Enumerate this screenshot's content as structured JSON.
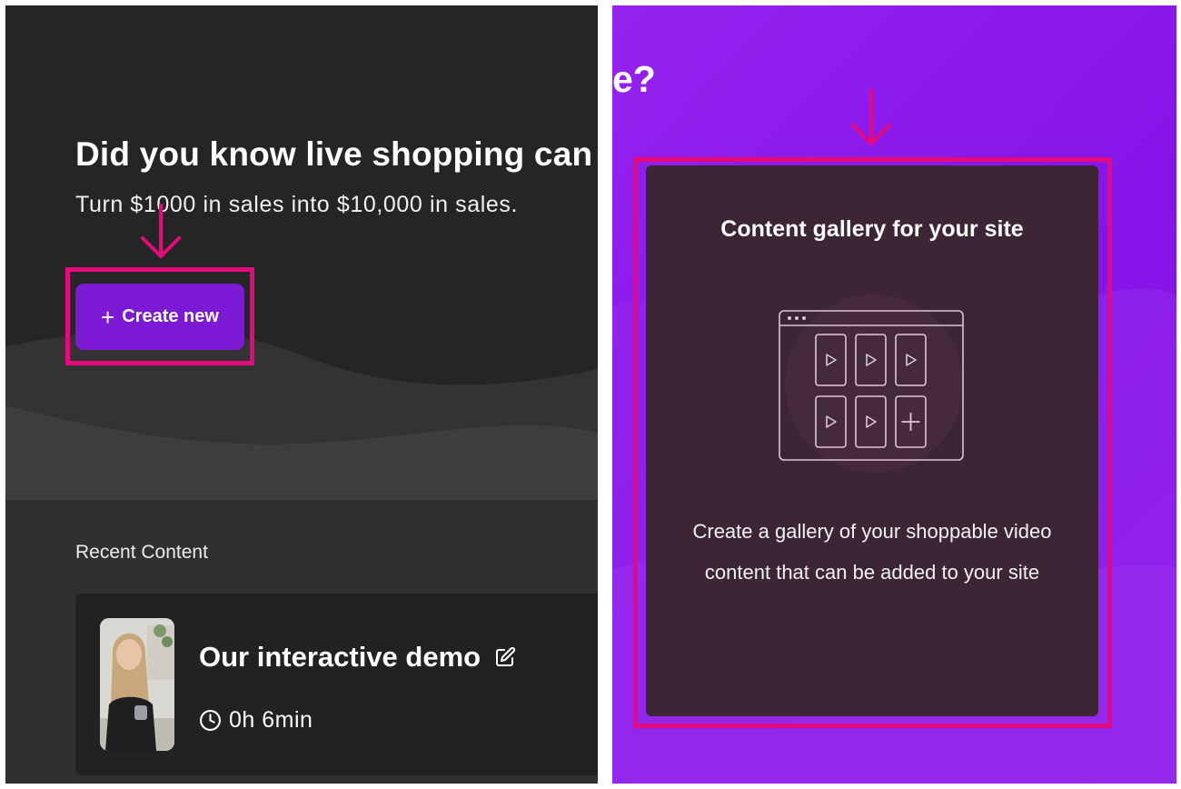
{
  "left": {
    "headline": "Did you know live shopping can d",
    "subheadline": "Turn $1000 in sales into $10,000 in sales.",
    "create_button": {
      "icon": "plus-icon",
      "label": "Create new"
    },
    "recent_label": "Recent Content",
    "recent_items": [
      {
        "title": "Our interactive demo",
        "duration": "0h 6min"
      }
    ]
  },
  "right": {
    "partial_heading": "e?",
    "gallery_card": {
      "title": "Content gallery for your site",
      "description": "Create a gallery of your shoppable video content that can be added to your site"
    }
  },
  "colors": {
    "highlight": "#e5097c",
    "button_purple": "#7c19d4",
    "right_background": "#8a18ea",
    "gallery_card_bg": "#3c2534"
  }
}
